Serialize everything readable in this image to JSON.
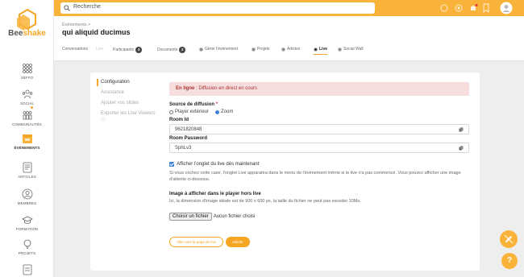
{
  "brand": {
    "part1": "Bee",
    "part2": "shake"
  },
  "sidebar": {
    "items": [
      {
        "label": "XEFFO",
        "icon": "grid-icon"
      },
      {
        "label": "SOCIAL",
        "icon": "users-icon"
      },
      {
        "label": "COMMUNAUTÉS",
        "icon": "community-icon"
      },
      {
        "label": "ÉVÉNEMENTS",
        "icon": "calendar-icon"
      },
      {
        "label": "ARTICLES",
        "icon": "article-icon"
      },
      {
        "label": "MEMBRES",
        "icon": "member-icon"
      },
      {
        "label": "FORMATION",
        "icon": "graduation-icon"
      },
      {
        "label": "PROJETS",
        "icon": "bulb-icon"
      },
      {
        "label": "",
        "icon": "document-icon"
      }
    ]
  },
  "search": {
    "placeholder": "Recherche"
  },
  "header": {
    "breadcrumb": "Événements  >",
    "title": "qui aliquid ducimus",
    "tabs": [
      {
        "label": "Conversations"
      },
      {
        "label": "Live"
      },
      {
        "label": "Participants",
        "badge": "3"
      },
      {
        "label": "Documents",
        "badge": "2"
      },
      {
        "label": "Gérer l'événement"
      },
      {
        "label": "Projets"
      },
      {
        "label": "Articles"
      },
      {
        "label": "Live"
      },
      {
        "label": "Social Wall"
      }
    ]
  },
  "menu": {
    "items": [
      "Configuration",
      "Assistance",
      "Ajouter vos slides",
      "Exporter les Live Viewers"
    ]
  },
  "form": {
    "alert_strong": "En ligne",
    "alert_text": " : Diffusion en direct en cours",
    "source_label": "Source de diffusion",
    "required_mark": "*",
    "radio_external": "Player extérieur",
    "radio_zoom": "Zoom",
    "room_id_label": "Room Id",
    "room_id_value": "9621820848",
    "room_pwd_label": "Room Password",
    "room_pwd_value": "SphLv3",
    "checkbox_label": "Afficher l'onglet du live dès maintenant",
    "checkbox_hint": "Si vous cochez cette case, l'onglet Live apparaitra dans le menu de l'événement même si le live n'a pas commencé. Vous pouvez afficher une image d'attente ci-dessous.",
    "image_label": "Image à afficher dans le player hors live",
    "image_hint": "Ici, la dimension d'image idéale est de 900 x 600 px, la taille du fichier ne peut pas exceder 10Mo.",
    "file_button": "Choisir un fichier",
    "file_status": "Aucun fichier choisi",
    "goto_button": "Aller vers la page de live",
    "submit_button": "Valider"
  },
  "colors": {
    "accent": "#f9b33a",
    "alert_bg": "#f6dede",
    "alert_text": "#aa3333",
    "radio_on": "#3b82d6"
  }
}
